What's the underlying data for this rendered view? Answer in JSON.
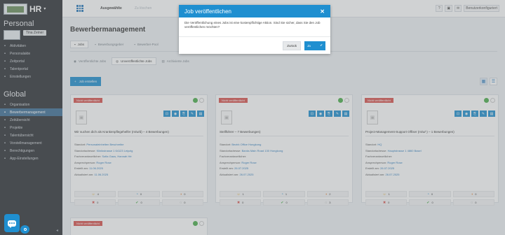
{
  "app": {
    "brand": "HR"
  },
  "sidebar": {
    "section_personal": "Personal",
    "user_name": "Tina Zeiner",
    "personal_items": [
      {
        "label": "Aktivitäten",
        "icon": "activity-icon"
      },
      {
        "label": "Personalakte",
        "icon": "file-icon"
      },
      {
        "label": "Zeitportal",
        "icon": "clock-icon"
      },
      {
        "label": "Talentportal",
        "icon": "star-icon"
      },
      {
        "label": "Einstellungen",
        "icon": "gear-icon"
      }
    ],
    "section_global": "Global",
    "global_items": [
      {
        "label": "Organisation",
        "icon": "org-icon"
      },
      {
        "label": "Bewerbermanagement",
        "icon": "applicants-icon",
        "active": true
      },
      {
        "label": "Zeitübersicht",
        "icon": "calendar-icon"
      },
      {
        "label": "Projekte",
        "icon": "projects-icon"
      },
      {
        "label": "Talentübersicht",
        "icon": "talent-icon"
      },
      {
        "label": "Vorstellmanagement",
        "icon": "interview-icon"
      },
      {
        "label": "Berechtigungen",
        "icon": "permissions-icon"
      },
      {
        "label": "App-Einstellungen",
        "icon": "settings-icon"
      }
    ]
  },
  "topbar": {
    "label": "Ausgewählte",
    "muted": "Zu löschen",
    "user_label": "Benutzerkonfiguriert"
  },
  "main": {
    "title": "Bewerbermanagement",
    "tabs": [
      "Jobs",
      "Bewerbungsgeber",
      "Bewerber-Pool"
    ],
    "subtabs": [
      "Veröffentlichte Jobs",
      "Unveröffentlichte Jobs",
      "Archivierte Jobs"
    ],
    "add_button": "Job erstellen"
  },
  "card_labels": {
    "badge": "Nicht veröffentlicht",
    "standort": "Standort:",
    "standorte": "Standortadresse:",
    "fachverantwortlicher": "Fachverantwortlicher:",
    "ansprechperson": "Ansprechperson:",
    "erstellt": "Erstellt am:",
    "aktualisiert": "Aktualisiert am:"
  },
  "cards": [
    {
      "title": "Wir suchen dich als Krankenpflegehelfer (m/w/d) – 4 Bewerbungen)",
      "standort": "Personaleinheiten Beschreibe",
      "standortadresse": "Klinikstrasse 1 64123 Leipzig",
      "fachverantwortlicher": "Sofia Gaus, Hannah Hé",
      "ansprechperson": "Roger Rose",
      "erstellt": "11.06.2025",
      "aktualisiert": "11.06.2025",
      "stats": [
        "4",
        "0",
        "0",
        "0",
        "0",
        "0"
      ]
    },
    {
      "title": "Stellführer – 7 Bewerbungen)",
      "standort": "Bezirk Office Hongkong",
      "standortadresse": "Banks Main Road 130 Hongkong",
      "fachverantwortlicher": "",
      "ansprechperson": "Roger Rose",
      "erstellt": "26.07.2025",
      "aktualisiert": "26.07.2025",
      "stats": [
        "1",
        "1",
        "2",
        "0",
        "0",
        "3"
      ]
    },
    {
      "title": "Project-Management-Support Offiser (m/w/-) – 1 Bewerbungen)",
      "standort": "HQ",
      "standortadresse": "Hauptstrasse 1 4860 Basel",
      "fachverantwortlicher": "",
      "ansprechperson": "Roger Rose",
      "erstellt": "26.07.2025",
      "aktualisiert": "26.07.2025",
      "stats": [
        "1",
        "0",
        "0",
        "0",
        "0",
        "0"
      ]
    }
  ],
  "partial_card": {
    "badge": "Nicht veröffentlicht"
  },
  "modal": {
    "title": "Job veröffentlichen",
    "close": "✕",
    "body": "Die Veröffentlichung eines Jobs ist eine kostenpflichtige Aktion. Sind Sie sicher, dass Sie den Job veröffentlichen möchten?",
    "back_label": "Zurück",
    "yes_label": "Ja",
    "yes_icon": "✔"
  },
  "colors": {
    "primary": "#1f8fd0",
    "sidebar": "#2f3237",
    "badge_red": "#d9534f",
    "green": "#4cae4c"
  }
}
